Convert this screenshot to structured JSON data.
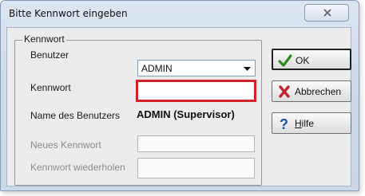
{
  "window": {
    "title": "Bitte Kennwort eingeben"
  },
  "group": {
    "legend": "Kennwort",
    "labels": {
      "benutzer": "Benutzer",
      "kennwort": "Kennwort",
      "name": "Name des Benutzers",
      "neues": "Neues Kennwort",
      "wiederholen": "Kennwort wiederholen"
    },
    "benutzer_value": "ADMIN",
    "name_value": "ADMIN (Supervisor)",
    "kennwort_value": "",
    "neues_value": "",
    "wiederholen_value": ""
  },
  "buttons": {
    "ok": "OK",
    "abbrechen": "Abbrechen",
    "hilfe": "Hilfe"
  },
  "colors": {
    "error_border": "#d2232a",
    "ok_check": "#2e8b1f",
    "cancel_x": "#c0262d",
    "help_mark": "#1f4fa8"
  }
}
